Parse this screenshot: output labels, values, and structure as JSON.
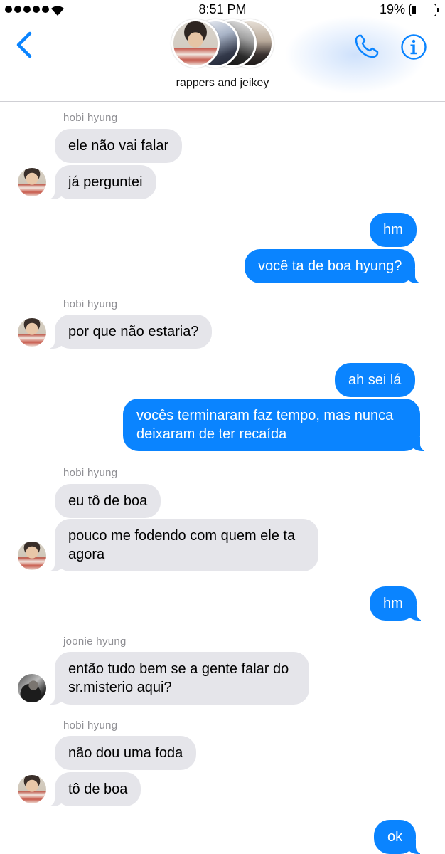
{
  "status_bar": {
    "time": "8:51 PM",
    "battery_percent_text": "19%",
    "battery_level": 0.19
  },
  "header": {
    "group_name": "rappers and jeikey"
  },
  "icons": {
    "back": "chevron-left-icon",
    "call": "phone-icon",
    "info": "info-icon",
    "signal": "signal-dots-icon",
    "wifi": "wifi-icon",
    "battery": "battery-icon"
  },
  "colors": {
    "accent": "#0a84ff",
    "incoming_bubble": "#e5e5ea",
    "sender_label": "#8e8e93"
  },
  "conversation": {
    "sender_1": "hobi hyung",
    "msg_1": "ele não vai falar",
    "msg_2": "já perguntei",
    "msg_3": "hm",
    "msg_4": "você ta de boa hyung?",
    "sender_2": "hobi hyung",
    "msg_5": "por que não estaria?",
    "msg_6": "ah sei lá",
    "msg_7a": "vocês terminaram faz tempo, mas nunca",
    "msg_7b": "deixaram de ter recaída",
    "sender_3": "hobi hyung",
    "msg_8": "eu tô de boa",
    "msg_9a": "pouco me fodendo com quem ele ta",
    "msg_9b": "agora",
    "msg_10": "hm",
    "sender_4": "joonie hyung",
    "msg_11a": "então tudo bem se a gente falar do",
    "msg_11b": "sr.misterio aqui?",
    "sender_5": "hobi hyung",
    "msg_12": "não dou uma foda",
    "msg_13": "tô de boa",
    "msg_14": "ok"
  }
}
